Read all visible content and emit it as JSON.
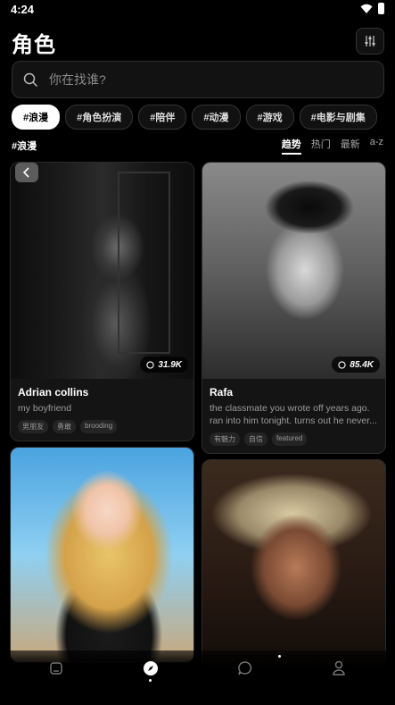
{
  "status": {
    "time": "4:24"
  },
  "header": {
    "title": "角色"
  },
  "search": {
    "placeholder": "你在找谁?"
  },
  "tags": [
    "#浪漫",
    "#角色扮演",
    "#陪伴",
    "#动漫",
    "#游戏",
    "#电影与剧集"
  ],
  "section": {
    "label": "#浪漫"
  },
  "sort": [
    "趋势",
    "热门",
    "最新",
    "a-z"
  ],
  "cards": [
    {
      "name": "Adrian collins",
      "desc": "my boyfriend",
      "count": "31.9K",
      "tags": [
        "男朋友",
        "勇敢",
        "brooding"
      ]
    },
    {
      "name": "Rafa",
      "desc_line1": "the classmate you wrote off years ago.",
      "desc_line2": "ran into him tonight. turns out he never...",
      "count": "85.4K",
      "tags": [
        "有魅力",
        "自信",
        "featured"
      ]
    }
  ],
  "nav": [
    "home-icon",
    "compass-icon",
    "chat-icon",
    "profile-icon"
  ]
}
